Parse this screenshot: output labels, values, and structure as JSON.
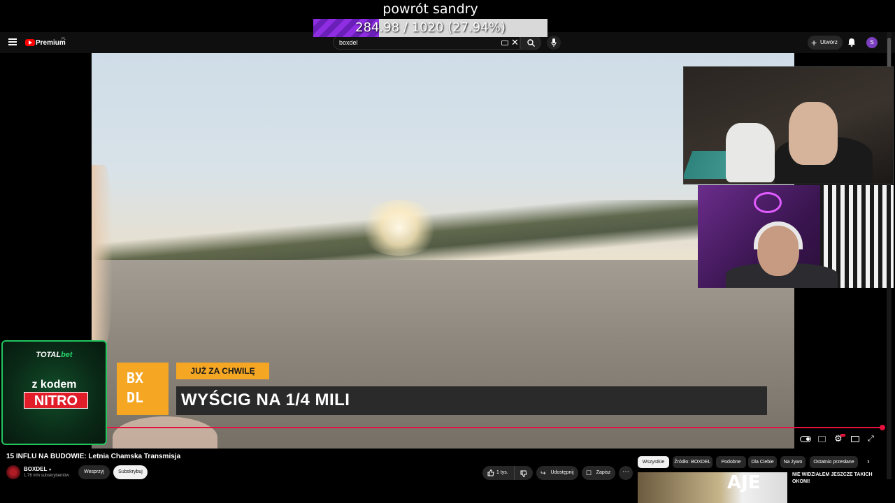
{
  "overlay": {
    "title": "powrót sandry",
    "progress_text": "284.98 / 1020 (27.94%)",
    "progress_fraction": 0.2794,
    "progress_color": "#8e2de2"
  },
  "topbar": {
    "menu_icon": "menu-icon",
    "logo_label": "Premium",
    "country_code": "PL",
    "search_value": "boxdel",
    "create_label": "Utwórz",
    "avatar_letter": "S",
    "avatar_color": "#7b3fbf"
  },
  "video": {
    "ad": {
      "brand_total": "TOTAL",
      "brand_bet": "bet",
      "line1": "z kodem",
      "code": "NITRO"
    },
    "lower_third": {
      "logo_text": "BX DL",
      "tag": "JUŻ ZA CHWILĘ",
      "headline": "WYŚCIG NA 1/4 MILI"
    },
    "progress_fraction": 0.995,
    "accent_color": "#e4123c"
  },
  "details": {
    "title": "15 INFLU NA BUDOWIE: Letnia Chamska Transmisja",
    "channel": "BOXDEL",
    "subscribers": "1,76 mln subskrybentów",
    "support_label": "Wesprzyj",
    "subscribe_label": "Subskrybuj",
    "likes": "1 tys.",
    "share_label": "Udostępnij",
    "save_label": "Zapisz"
  },
  "chips": [
    {
      "label": "Wszystkie",
      "active": true
    },
    {
      "label": "Źródło: BOXDEL",
      "active": false
    },
    {
      "label": "Podobne",
      "active": false
    },
    {
      "label": "Dla Ciebie",
      "active": false
    },
    {
      "label": "Na żywo",
      "active": false
    },
    {
      "label": "Ostatnio przesłane",
      "active": false
    }
  ],
  "recommendation": {
    "thumb_text": "AJE",
    "title": "NIE WIDZIAŁEM JESZCZE TAKICH OKONI!"
  }
}
